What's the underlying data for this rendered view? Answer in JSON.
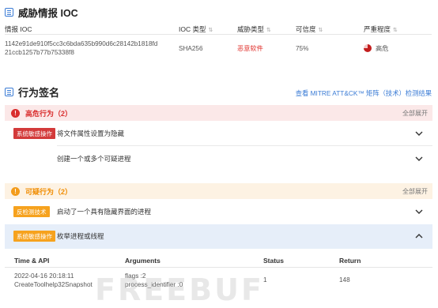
{
  "ioc_section": {
    "title": "威胁情报 IOC",
    "columns": {
      "ioc": "情报 IOC",
      "type": "IOC 类型",
      "threat": "威胁类型",
      "confidence": "可信度",
      "severity": "严重程度"
    },
    "rows": [
      {
        "hash_line1": "1142e91de910f5cc3c6bda635b990d6c28142b1818fd",
        "hash_line2": "21ccb1257b77b75338f8",
        "ioc_type": "SHA256",
        "threat": "恶意软件",
        "confidence": "75%",
        "severity": "高危",
        "severity_level": 0.75
      }
    ]
  },
  "behavior_section": {
    "title": "行为签名",
    "mitre_link": "查看 MITRE ATT&CK™ 矩阵（技术）检测结果",
    "groups": [
      {
        "title": "高危行为（2）",
        "expand_all": "全部展开",
        "items": [
          {
            "tag": "系统敏感操作",
            "text": "将文件属性设置为隐藏"
          },
          {
            "tag": "",
            "text": "创建一个或多个可疑进程"
          }
        ]
      },
      {
        "title": "可疑行为（2）",
        "expand_all": "全部展开",
        "items": [
          {
            "tag": "反检测技术",
            "text": "启动了一个具有隐藏界面的进程"
          },
          {
            "tag": "系统敏感操作",
            "text": "枚举进程或线程"
          }
        ]
      }
    ],
    "detail": {
      "columns": {
        "time": "Time & API",
        "args": "Arguments",
        "status": "Status",
        "ret": "Return"
      },
      "row": {
        "time": "2022-04-16 20:18:11",
        "api": "CreateToolhelp32Snapshot",
        "arg1": "flags :2",
        "arg2": "process_identifier :0",
        "status": "1",
        "ret": "148"
      }
    }
  },
  "watermark": "FREEBUF",
  "colors": {
    "accent": "#3a7bd5",
    "high_risk": "#d92d2d",
    "suspicious": "#f08c00",
    "expanded_bg": "#e6eef9"
  }
}
